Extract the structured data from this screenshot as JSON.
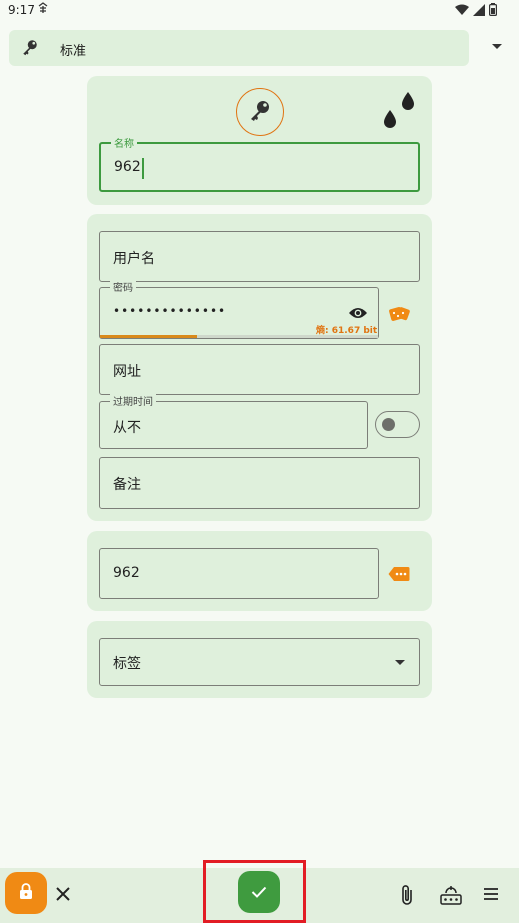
{
  "status_bar": {
    "time": "9:17"
  },
  "template": {
    "label": "标准"
  },
  "entry": {
    "name_label": "名称",
    "name_value": "962"
  },
  "fields": {
    "username_placeholder": "用户名",
    "password_label": "密码",
    "password_value": "••••••••••••••",
    "entropy": "熵: 61.67 bit",
    "url_placeholder": "网址",
    "expiry_label": "过期时间",
    "expiry_value": "从不",
    "notes_placeholder": "备注"
  },
  "custom_field": {
    "value": "962"
  },
  "tags": {
    "placeholder": "标签"
  },
  "colors": {
    "accent_green": "#3d9a3f",
    "accent_orange": "#f08a14",
    "card_bg": "#dff0dc",
    "highlight": "#e21c24"
  },
  "password_strength": 0.35
}
